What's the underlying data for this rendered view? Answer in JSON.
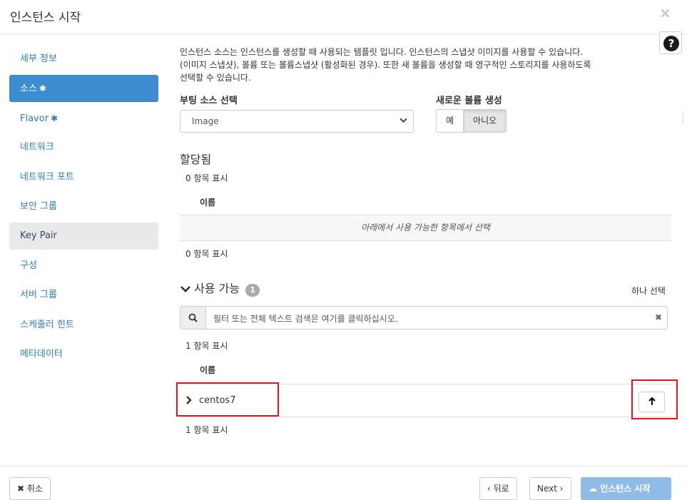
{
  "modal": {
    "title": "인스턴스 시작",
    "close": "×",
    "help": "?"
  },
  "sidebar": {
    "items": [
      {
        "label": "세부 정보",
        "required": ""
      },
      {
        "label": "소스",
        "required": "✱"
      },
      {
        "label": "Flavor",
        "required": "✱"
      },
      {
        "label": "네트워크",
        "required": ""
      },
      {
        "label": "네트워크 포트",
        "required": ""
      },
      {
        "label": "보안 그룹",
        "required": ""
      },
      {
        "label": "Key Pair",
        "required": ""
      },
      {
        "label": "구성",
        "required": ""
      },
      {
        "label": "서버 그룹",
        "required": ""
      },
      {
        "label": "스케줄러 힌트",
        "required": ""
      },
      {
        "label": "메타데이터",
        "required": ""
      }
    ],
    "active_index": 1,
    "hover_index": 6
  },
  "source": {
    "description_lines": [
      "인스턴스 소스는 인스턴스를 생성할 때 사용되는 템플릿 입니다. 인스턴스의 스냅샷 이미지를 사용할 수 있습니다.",
      "(이미지 스냅샷), 볼륨 또는 볼륨스냅샷 (활성화된 경우). 또한 새 볼륨을 생성할 때 영구적인 스토리지를 사용하도록",
      "선택할 수 있습니다."
    ],
    "boot_source_label": "부팅 소스 선택",
    "boot_source_value": "Image",
    "new_volume_label": "새로운 볼륨 생성",
    "new_volume_options": [
      "예",
      "아니오"
    ],
    "new_volume_selected": "아니오"
  },
  "allocated": {
    "title": "할당됨",
    "count_top": "0 항목 표시",
    "column_name": "이름",
    "empty_message": "아래에서 사용 가능한 항목에서 선택",
    "count_bottom": "0 항목 표시"
  },
  "available": {
    "title": "사용 가능",
    "badge": "1",
    "select_one": "하나 선택",
    "search_placeholder": "필터 또는 전체 텍스트 검색은 여기를 클릭하십시오.",
    "count_top": "1 항목 표시",
    "column_name": "이름",
    "rows": [
      {
        "name": "centos7"
      }
    ],
    "count_bottom": "1 항목 표시"
  },
  "footer": {
    "cancel": "취소",
    "back": "뒤로",
    "next": "Next",
    "launch": "인스턴스 시작"
  },
  "colors": {
    "active_nav": "#3d8ccf",
    "link": "#2f7bc0",
    "primary_disabled": "#8fbce6",
    "highlight_box": "#e2161b"
  },
  "icons": [
    "close-icon",
    "help-icon",
    "chevron-down-icon",
    "search-icon",
    "clear-icon",
    "chevron-right-icon",
    "arrow-up-icon",
    "cloud-upload-icon"
  ]
}
